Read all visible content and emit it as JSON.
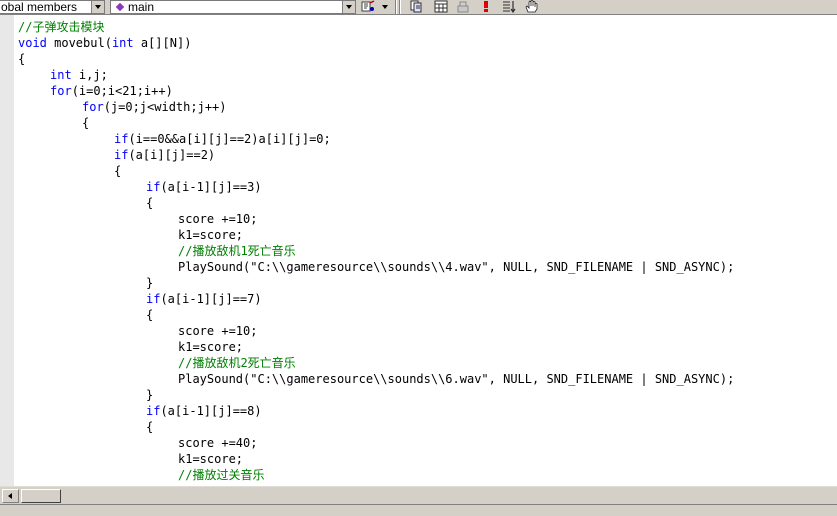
{
  "toolbar": {
    "scope_combo": {
      "value": "obal members"
    },
    "members_combo": {
      "value": "main"
    },
    "buttons": [
      {
        "icon": "filter-wand-icon"
      },
      {
        "icon": "dropdown-arrow-icon"
      },
      {
        "icon": "breakpoint-list-icon"
      },
      {
        "icon": "workspace-icon"
      },
      {
        "icon": "compile-icon"
      },
      {
        "icon": "build-exclamation-icon"
      },
      {
        "icon": "step-into-icon"
      },
      {
        "icon": "hand-icon"
      }
    ]
  },
  "editor": {
    "colors": {
      "keyword": "#0000ff",
      "comment": "#008000",
      "text": "#000000"
    },
    "lines": [
      {
        "indent": 0,
        "segs": [
          {
            "t": "//子弹攻击模块",
            "c": "cm"
          }
        ]
      },
      {
        "indent": 0,
        "segs": [
          {
            "t": "void",
            "c": "kw"
          },
          {
            "t": " movebul("
          },
          {
            "t": "int",
            "c": "kw"
          },
          {
            "t": " a[][N])"
          }
        ]
      },
      {
        "indent": 0,
        "segs": [
          {
            "t": "{"
          }
        ]
      },
      {
        "indent": 1,
        "segs": [
          {
            "t": "int",
            "c": "kw"
          },
          {
            "t": " i,j;"
          }
        ]
      },
      {
        "indent": 1,
        "segs": [
          {
            "t": "for",
            "c": "kw"
          },
          {
            "t": "(i=0;i<21;i++)"
          }
        ]
      },
      {
        "indent": 2,
        "segs": [
          {
            "t": "for",
            "c": "kw"
          },
          {
            "t": "(j=0;j<width;j++)"
          }
        ]
      },
      {
        "indent": 2,
        "segs": [
          {
            "t": "{"
          }
        ]
      },
      {
        "indent": 3,
        "segs": [
          {
            "t": "if",
            "c": "kw"
          },
          {
            "t": "(i==0&&a[i][j]==2)a[i][j]=0;"
          }
        ]
      },
      {
        "indent": 3,
        "segs": [
          {
            "t": "if",
            "c": "kw"
          },
          {
            "t": "(a[i][j]==2)"
          }
        ]
      },
      {
        "indent": 3,
        "segs": [
          {
            "t": "{"
          }
        ]
      },
      {
        "indent": 4,
        "segs": [
          {
            "t": "if",
            "c": "kw"
          },
          {
            "t": "(a[i-1][j]==3)"
          }
        ]
      },
      {
        "indent": 4,
        "segs": [
          {
            "t": "{"
          }
        ]
      },
      {
        "indent": 5,
        "segs": [
          {
            "t": "score +=10;"
          }
        ]
      },
      {
        "indent": 5,
        "segs": [
          {
            "t": "k1=score;"
          }
        ]
      },
      {
        "indent": 5,
        "segs": [
          {
            "t": "//播放敌机1死亡音乐",
            "c": "cm"
          }
        ]
      },
      {
        "indent": 5,
        "segs": [
          {
            "t": "PlaySound(\"C:\\\\gameresource\\\\sounds\\\\4.wav\", NULL, SND_FILENAME | SND_ASYNC);"
          }
        ]
      },
      {
        "indent": 4,
        "segs": [
          {
            "t": "}"
          }
        ]
      },
      {
        "indent": 4,
        "segs": [
          {
            "t": "if",
            "c": "kw"
          },
          {
            "t": "(a[i-1][j]==7)"
          }
        ]
      },
      {
        "indent": 4,
        "segs": [
          {
            "t": "{"
          }
        ]
      },
      {
        "indent": 5,
        "segs": [
          {
            "t": "score +=10;"
          }
        ]
      },
      {
        "indent": 5,
        "segs": [
          {
            "t": "k1=score;"
          }
        ]
      },
      {
        "indent": 5,
        "segs": [
          {
            "t": "//播放敌机2死亡音乐",
            "c": "cm"
          }
        ]
      },
      {
        "indent": 5,
        "segs": [
          {
            "t": "PlaySound(\"C:\\\\gameresource\\\\sounds\\\\6.wav\", NULL, SND_FILENAME | SND_ASYNC);"
          }
        ]
      },
      {
        "indent": 4,
        "segs": [
          {
            "t": "}"
          }
        ]
      },
      {
        "indent": 4,
        "segs": [
          {
            "t": "if",
            "c": "kw"
          },
          {
            "t": "(a[i-1][j]==8)"
          }
        ]
      },
      {
        "indent": 4,
        "segs": [
          {
            "t": "{"
          }
        ]
      },
      {
        "indent": 5,
        "segs": [
          {
            "t": "score +=40;"
          }
        ]
      },
      {
        "indent": 5,
        "segs": [
          {
            "t": "k1=score;"
          }
        ]
      },
      {
        "indent": 5,
        "segs": [
          {
            "t": "//播放过关音乐",
            "c": "cm"
          }
        ]
      }
    ]
  }
}
